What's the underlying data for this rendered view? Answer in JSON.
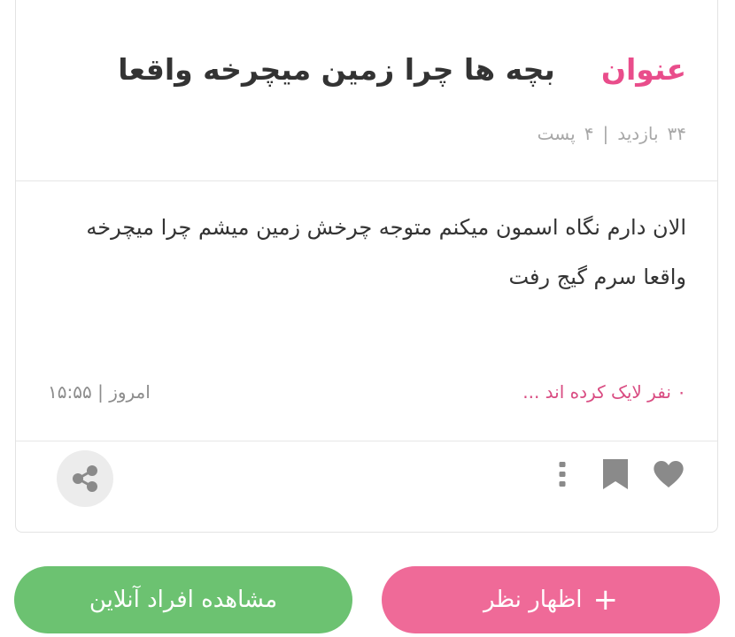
{
  "post": {
    "title_label": "عنوان",
    "title": "بچه ها چرا زمین میچرخه واقعا",
    "views_count": "۳۴",
    "views_label": "بازدید",
    "separator": "|",
    "posts_count": "۴",
    "posts_label": "پست",
    "body": "الان دارم نگاه اسمون میکنم متوجه چرخش زمین میشم چرا میچرخه واقعا سرم گیج رفت",
    "likes_text": "۰ نفر لایک کرده اند ...",
    "time_label": "امروز",
    "time_value": "۱۵:۵۵"
  },
  "actions": {
    "icons": [
      "heart-icon",
      "bookmark-icon",
      "more-vertical-icon",
      "share-icon"
    ]
  },
  "buttons": {
    "comment_plus": "+",
    "comment_label": "اظهار نظر",
    "online_label": "مشاهده افراد آنلاین"
  },
  "colors": {
    "accent_pink": "#e94d8b",
    "comment_button": "#ef6a98",
    "online_button": "#6cc271",
    "icon_gray": "#8a8a8a"
  }
}
